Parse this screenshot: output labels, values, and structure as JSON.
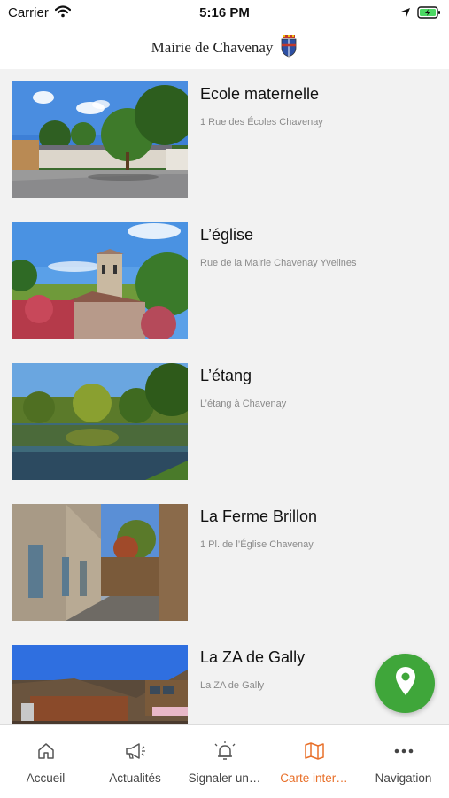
{
  "status_bar": {
    "carrier": "Carrier",
    "time": "5:16 PM"
  },
  "header": {
    "title": "Mairie de Chavenay"
  },
  "places": [
    {
      "title": "Ecole maternelle",
      "address": "1 Rue des Écoles Chavenay"
    },
    {
      "title": "L’église",
      "address": "Rue de la Mairie Chavenay Yvelines"
    },
    {
      "title": "L’étang",
      "address": "L’étang à Chavenay"
    },
    {
      "title": "La Ferme Brillon",
      "address": "1 Pl. de l’Église Chavenay"
    },
    {
      "title": "La ZA de Gally",
      "address": "La ZA de Gally"
    }
  ],
  "fab": {
    "icon": "map-pin-icon",
    "color": "#3fa63a"
  },
  "tab_bar": {
    "active_color": "#e8702a",
    "tabs": [
      {
        "label": "Accueil",
        "icon": "home-icon"
      },
      {
        "label": "Actualités",
        "icon": "megaphone-icon"
      },
      {
        "label": "Signaler un…",
        "icon": "bell-alert-icon"
      },
      {
        "label": "Carte inter…",
        "icon": "map-icon"
      },
      {
        "label": "Navigation",
        "icon": "more-dots-icon"
      }
    ]
  }
}
